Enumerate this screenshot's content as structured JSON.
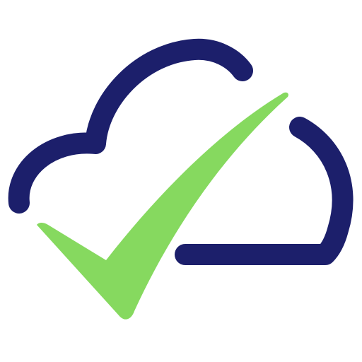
{
  "logo": {
    "icon": "cloud-check-icon",
    "colors": {
      "background": "#ffffff",
      "cloud_outline": "#1c1f6b",
      "checkmark": "#86d95f"
    }
  }
}
